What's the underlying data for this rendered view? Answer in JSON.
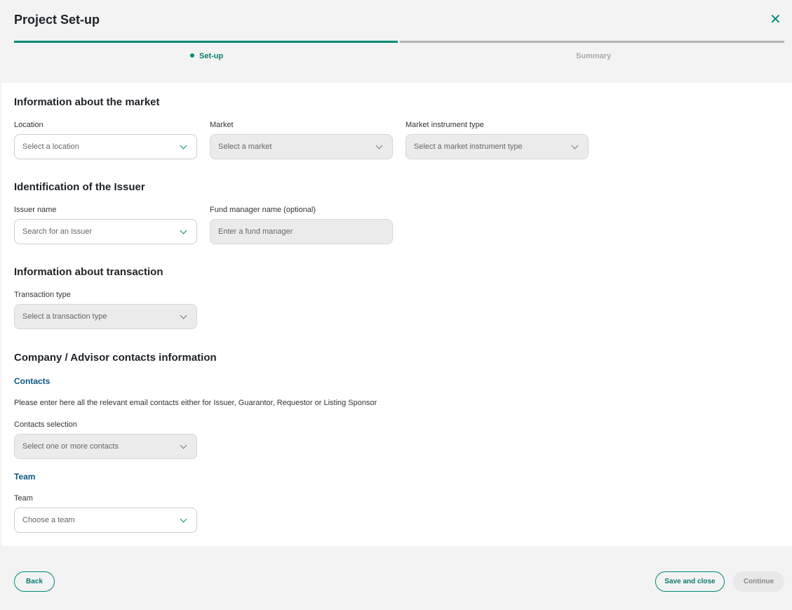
{
  "header": {
    "title": "Project Set-up",
    "steps": [
      {
        "label": "Set-up",
        "active": true
      },
      {
        "label": "Summary",
        "active": false
      }
    ]
  },
  "colors": {
    "accent": "#00897b",
    "heading_blue": "#0a5783"
  },
  "sections": {
    "market": {
      "title": "Information about the market",
      "location_label": "Location",
      "location_placeholder": "Select a location",
      "market_label": "Market",
      "market_placeholder": "Select a market",
      "instrument_label": "Market instrument type",
      "instrument_placeholder": "Select a market instrument type"
    },
    "issuer": {
      "title": "Identification of the Issuer",
      "issuer_label": "Issuer name",
      "issuer_placeholder": "Search for an Issuer",
      "fund_label": "Fund manager name (optional)",
      "fund_placeholder": "Enter a fund manager"
    },
    "transaction": {
      "title": "Information about transaction",
      "type_label": "Transaction type",
      "type_placeholder": "Select a transaction type"
    },
    "contacts": {
      "title": "Company / Advisor contacts information",
      "sub_contacts": "Contacts",
      "description": "Please enter here all the relevant email contacts either for Issuer, Guarantor, Requestor or Listing Sponsor",
      "selection_label": "Contacts selection",
      "selection_placeholder": "Select one or more contacts",
      "sub_team": "Team",
      "team_label": "Team",
      "team_placeholder": "Choose a team"
    }
  },
  "footer": {
    "back": "Back",
    "save": "Save and close",
    "continue": "Continue"
  }
}
